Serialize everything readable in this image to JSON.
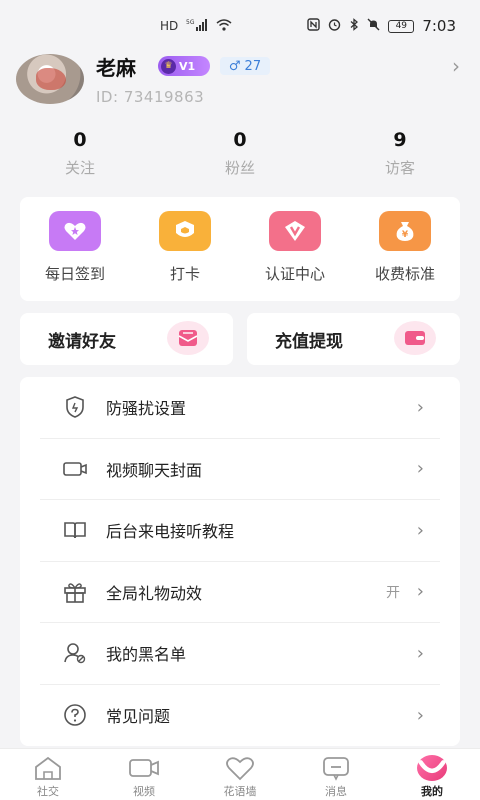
{
  "status_bar": {
    "network": "HD",
    "signal_badge": "5G",
    "battery": "49",
    "time": "7:03"
  },
  "profile": {
    "nickname": "老麻",
    "vip_level": "V1",
    "gender_age": "27",
    "id_label": "ID:",
    "id_value": "73419863"
  },
  "stats": [
    {
      "value": "0",
      "label": "关注"
    },
    {
      "value": "0",
      "label": "粉丝"
    },
    {
      "value": "9",
      "label": "访客"
    }
  ],
  "quick_actions": [
    {
      "label": "每日签到",
      "color": "#c77af5"
    },
    {
      "label": "打卡",
      "color": "#f9b13a"
    },
    {
      "label": "认证中心",
      "color": "#f3708a"
    },
    {
      "label": "收费标准",
      "color": "#f69646"
    }
  ],
  "promo": {
    "invite": "邀请好友",
    "recharge": "充值提现"
  },
  "settings": [
    {
      "label": "防骚扰设置",
      "icon": "shield-icon",
      "value": ""
    },
    {
      "label": "视频聊天封面",
      "icon": "video-camera-icon",
      "value": ""
    },
    {
      "label": "后台来电接听教程",
      "icon": "book-icon",
      "value": ""
    },
    {
      "label": "全局礼物动效",
      "icon": "gift-icon",
      "value": "开"
    },
    {
      "label": "我的黑名单",
      "icon": "blocked-user-icon",
      "value": ""
    },
    {
      "label": "常见问题",
      "icon": "question-icon",
      "value": ""
    }
  ],
  "tabbar": [
    {
      "label": "社交",
      "icon": "home-icon"
    },
    {
      "label": "视频",
      "icon": "video-icon"
    },
    {
      "label": "花语墙",
      "icon": "heart-icon"
    },
    {
      "label": "消息",
      "icon": "message-icon"
    },
    {
      "label": "我的",
      "icon": "me-icon",
      "active": true
    }
  ],
  "colors": {
    "background": "#f4f4f6",
    "vip_badge": "#9b5cf0",
    "gender_badge": "#3d7fd8",
    "active_tab": "#e83c7a"
  }
}
